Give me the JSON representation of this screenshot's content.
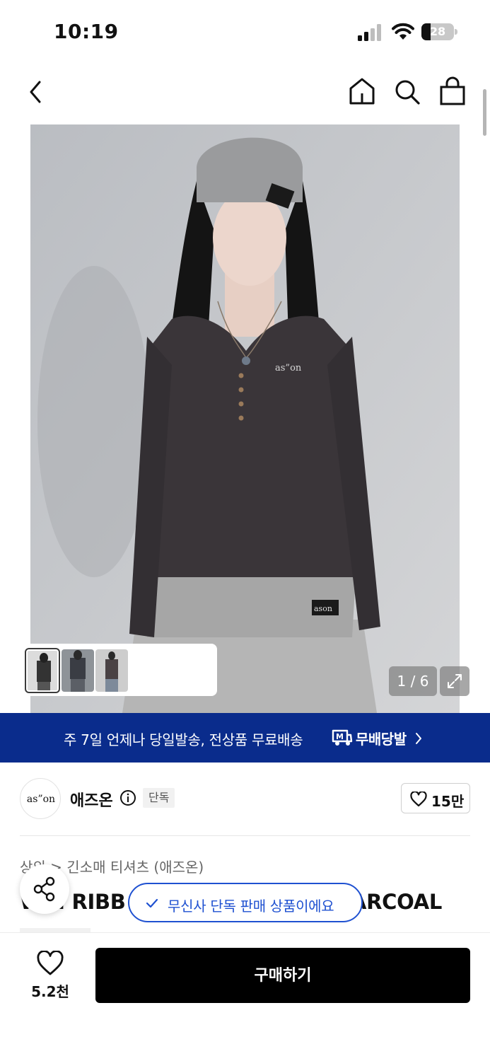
{
  "status": {
    "time": "10:19",
    "battery": "28",
    "battery_level": 0.28
  },
  "gallery": {
    "page_indicator": "1 / 6",
    "current_index": 1,
    "total": 6,
    "thumbnails": [
      "thumb-front",
      "thumb-dark",
      "thumb-side"
    ],
    "brand_text": "as”on",
    "brand_tag": "ason"
  },
  "shipping": {
    "text": "주 7일 언제나 당일발송, 전상품 무료배송",
    "brand": "무배당발",
    "logo_letter": "M",
    "color": "#0a2c8c"
  },
  "brand": {
    "logo_text": "as”on",
    "name": "애즈온",
    "badge": "단독",
    "like_count": "15만"
  },
  "product": {
    "breadcrumb": [
      "상의",
      "긴소매 티셔츠 (애즈온)"
    ],
    "breadcrumb_separator": ">",
    "title_left": "W",
    "title_visible": "H RIBB",
    "title_right": "ARCOAL"
  },
  "toast": {
    "text": "무신사 단독 판매 상품이에요",
    "color": "#1f51d1"
  },
  "bottom_bar": {
    "wish_count": "5.2천",
    "buy_label": "구매하기"
  },
  "icons": {
    "back": "chevron-left-icon",
    "home": "home-icon",
    "search": "search-icon",
    "bag": "shopping-bag-icon",
    "expand": "expand-icon",
    "share": "share-icon",
    "heart": "heart-icon",
    "info": "info-icon",
    "check": "check-icon"
  }
}
